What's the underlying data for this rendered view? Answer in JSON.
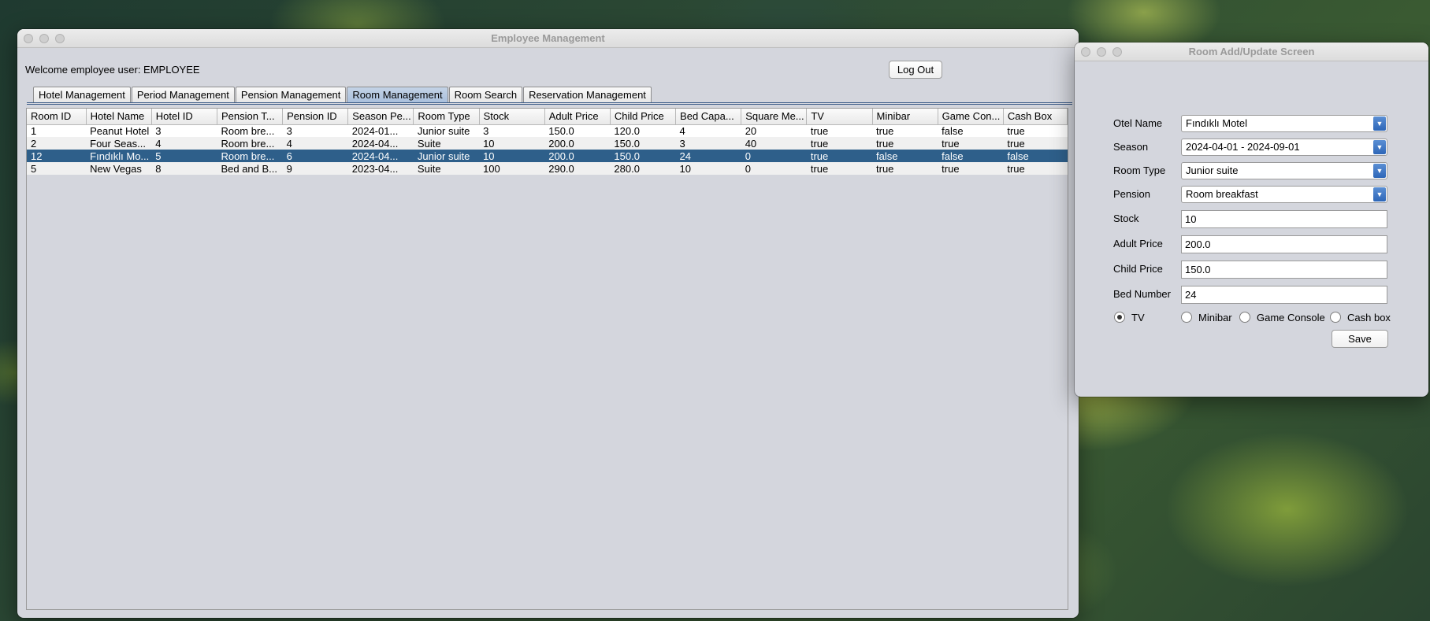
{
  "main_window": {
    "title": "Employee Management",
    "welcome": "Welcome employee user: EMPLOYEE",
    "logout_label": "Log Out",
    "tabs": [
      {
        "label": "Hotel Management"
      },
      {
        "label": "Period Management"
      },
      {
        "label": "Pension Management"
      },
      {
        "label": "Room Management"
      },
      {
        "label": "Room Search"
      },
      {
        "label": "Reservation Management"
      }
    ],
    "active_tab": "Room Management",
    "table": {
      "columns": [
        "Room ID",
        "Hotel Name",
        "Hotel ID",
        "Pension T...",
        "Pension ID",
        "Season Pe...",
        "Room Type",
        "Stock",
        "Adult Price",
        "Child Price",
        "Bed Capa...",
        "Square Me...",
        "TV",
        "Minibar",
        "Game Con...",
        "Cash Box"
      ],
      "rows": [
        [
          "1",
          "Peanut Hotel",
          "3",
          "Room bre...",
          "3",
          "2024-01...",
          "Junior suite",
          "3",
          "150.0",
          "120.0",
          "4",
          "20",
          "true",
          "true",
          "false",
          "true"
        ],
        [
          "2",
          "Four Seas...",
          "4",
          "Room bre...",
          "4",
          "2024-04...",
          "Suite",
          "10",
          "200.0",
          "150.0",
          "3",
          "40",
          "true",
          "true",
          "true",
          "true"
        ],
        [
          "12",
          "Fındıklı Mo...",
          "5",
          "Room bre...",
          "6",
          "2024-04...",
          "Junior suite",
          "10",
          "200.0",
          "150.0",
          "24",
          "0",
          "true",
          "false",
          "false",
          "false"
        ],
        [
          "5",
          "New Vegas",
          "8",
          "Bed and B...",
          "9",
          "2023-04...",
          "Suite",
          "100",
          "290.0",
          "280.0",
          "10",
          "0",
          "true",
          "true",
          "true",
          "true"
        ]
      ],
      "selected_row": 2
    }
  },
  "side_window": {
    "title": "Room Add/Update Screen",
    "fields": {
      "otel_name": {
        "label": "Otel Name",
        "value": "Fındıklı Motel"
      },
      "season": {
        "label": "Season",
        "value": "2024-04-01 - 2024-09-01"
      },
      "room_type": {
        "label": "Room Type",
        "value": "Junior suite"
      },
      "pension": {
        "label": "Pension",
        "value": "Room breakfast"
      },
      "stock": {
        "label": "Stock",
        "value": "10"
      },
      "adult_price": {
        "label": "Adult Price",
        "value": "200.0"
      },
      "child_price": {
        "label": "Child Price",
        "value": "150.0"
      },
      "bed_number": {
        "label": "Bed Number",
        "value": "24"
      }
    },
    "options": [
      {
        "label": "TV",
        "selected": true
      },
      {
        "label": "Minibar",
        "selected": false
      },
      {
        "label": "Game Console",
        "selected": false
      },
      {
        "label": "Cash box",
        "selected": false
      }
    ],
    "save_label": "Save"
  }
}
